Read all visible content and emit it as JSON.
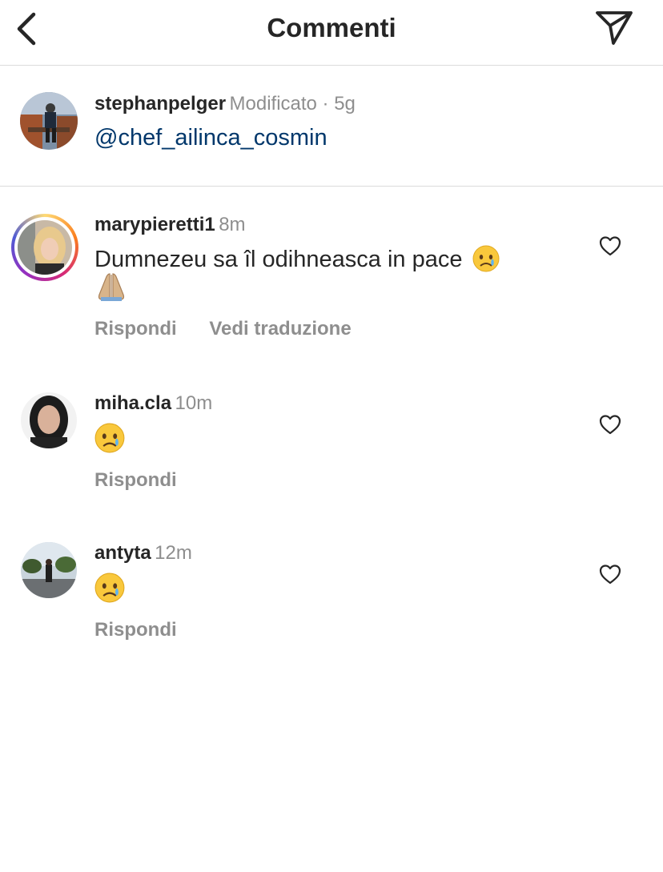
{
  "header": {
    "title": "Commenti",
    "back_icon": "chevron-left-icon",
    "send_icon": "paper-plane-icon"
  },
  "caption": {
    "username": "stephanpelger",
    "meta": "Modificato · 5g",
    "text": "@chef_ailinca_cosmin"
  },
  "comments": [
    {
      "username": "marypieretti1",
      "time": "8m",
      "text": "Dumnezeu sa îl odihneasca in pace",
      "emoji": [
        "crying-face",
        "folded-hands"
      ],
      "reply_label": "Rispondi",
      "translate_label": "Vedi traduzione",
      "has_story_ring": true
    },
    {
      "username": "miha.cla",
      "time": "10m",
      "text": "",
      "emoji": [
        "crying-face"
      ],
      "reply_label": "Rispondi"
    },
    {
      "username": "antyta",
      "time": "12m",
      "text": "",
      "emoji": [
        "crying-face"
      ],
      "reply_label": "Rispondi"
    }
  ],
  "colors": {
    "text": "#262626",
    "secondary": "#8e8e8e",
    "mention": "#00376b",
    "divider": "#dbdbdb"
  }
}
